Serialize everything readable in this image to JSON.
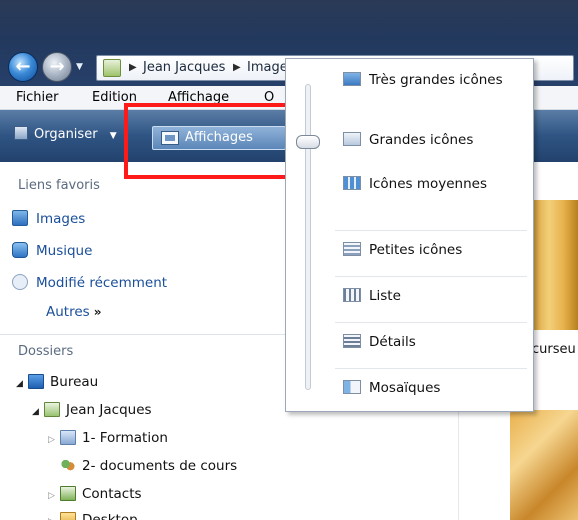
{
  "address": {
    "crumbs": [
      "Jean Jacques",
      "Images"
    ]
  },
  "menubar": {
    "items": [
      "Fichier",
      "Edition",
      "Affichage",
      "O"
    ]
  },
  "commandbar": {
    "organiser_label": "Organiser",
    "affichages_label": "Affichages"
  },
  "leftpane": {
    "favorites_heading": "Liens favoris",
    "favorites": [
      {
        "label": "Images",
        "icon": "pictures-icon"
      },
      {
        "label": "Musique",
        "icon": "music-icon"
      },
      {
        "label": "Modifié récemment",
        "icon": "recent-icon"
      }
    ],
    "more_label": "Autres",
    "more_glyph": "»",
    "folders_heading": "Dossiers",
    "tree": [
      {
        "label": "Bureau",
        "icon": "desktop-icon"
      },
      {
        "label": "Jean Jacques",
        "icon": "user-folder-icon"
      },
      {
        "label": "1- Formation",
        "icon": "folder-icon"
      },
      {
        "label": "2- documents de cours",
        "icon": "shared-folder-icon"
      },
      {
        "label": "Contacts",
        "icon": "contacts-icon"
      },
      {
        "label": "Desktop",
        "icon": "folder-icon"
      }
    ]
  },
  "content": {
    "partial_item_label": "curseu"
  },
  "view_menu": {
    "items": [
      {
        "label": "Très grandes icônes",
        "icon": "extra-large-icons-icon"
      },
      {
        "label": "Grandes icônes",
        "icon": "large-icons-icon"
      },
      {
        "label": "Icônes moyennes",
        "icon": "medium-icons-icon"
      },
      {
        "label": "Petites icônes",
        "icon": "small-icons-icon"
      },
      {
        "label": "Liste",
        "icon": "list-icon"
      },
      {
        "label": "Détails",
        "icon": "details-icon"
      },
      {
        "label": "Mosaïques",
        "icon": "tiles-icon"
      }
    ],
    "selected": "Grandes icônes"
  },
  "colors": {
    "highlight_box": "#ff1a1a",
    "link": "#1a4f9a"
  }
}
